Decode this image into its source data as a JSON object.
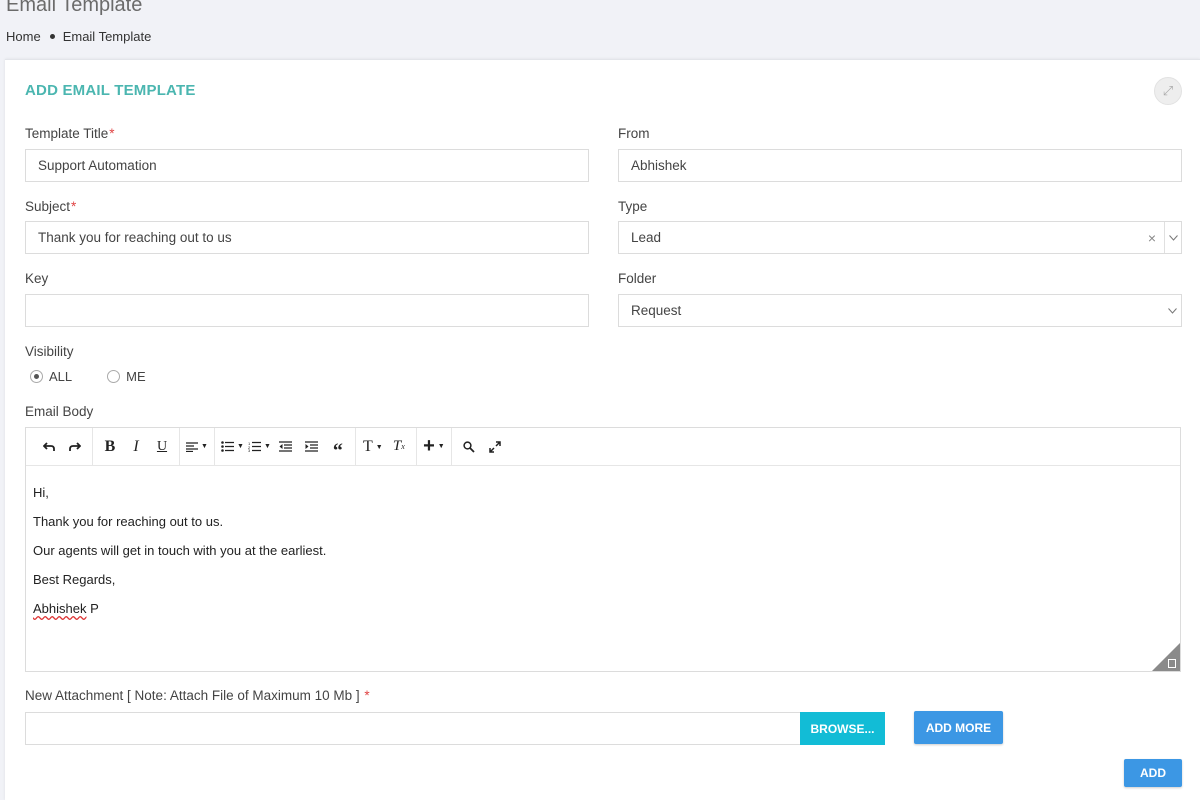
{
  "page": {
    "title": "Email Template",
    "breadcrumb": [
      "Home",
      "Email Template"
    ]
  },
  "card": {
    "title": "ADD EMAIL TEMPLATE"
  },
  "form": {
    "template_title": {
      "label": "Template Title",
      "required": "*",
      "value": "Support Automation"
    },
    "from": {
      "label": "From",
      "value": "Abhishek"
    },
    "subject": {
      "label": "Subject",
      "required": "*",
      "value": "Thank you for reaching out to us"
    },
    "type": {
      "label": "Type",
      "value": "Lead",
      "clear": "×"
    },
    "key": {
      "label": "Key",
      "value": ""
    },
    "folder": {
      "label": "Folder",
      "value": "Request"
    },
    "visibility": {
      "label": "Visibility",
      "options": [
        {
          "label": "ALL",
          "checked": true
        },
        {
          "label": "ME",
          "checked": false
        }
      ]
    },
    "email_body": {
      "label": "Email Body",
      "lines": [
        "Hi,",
        "Thank you for reaching out to us.",
        "Our agents will get in touch with you at the earliest.",
        "Best Regards,"
      ],
      "signature_first": "Abhishek",
      "signature_rest": " P"
    },
    "attachment": {
      "label": "New Attachment [ Note: Attach File of Maximum 10 Mb ]",
      "required": "*",
      "browse": "BROWSE...",
      "add_more": "ADD MORE"
    },
    "submit": "ADD"
  },
  "toolbar": {
    "icons": [
      "undo-icon",
      "redo-icon",
      "bold-icon",
      "italic-icon",
      "underline-icon",
      "align-icon",
      "bullet-list-icon",
      "numbered-list-icon",
      "outdent-icon",
      "indent-icon",
      "blockquote-icon",
      "font-size-icon",
      "clear-format-icon",
      "insert-icon",
      "search-icon",
      "fullscreen-icon"
    ]
  },
  "colors": {
    "accent_title": "#4bb6b0",
    "browse_button": "#12bcd6",
    "primary_button": "#3c97e4",
    "required": "#e04444"
  }
}
